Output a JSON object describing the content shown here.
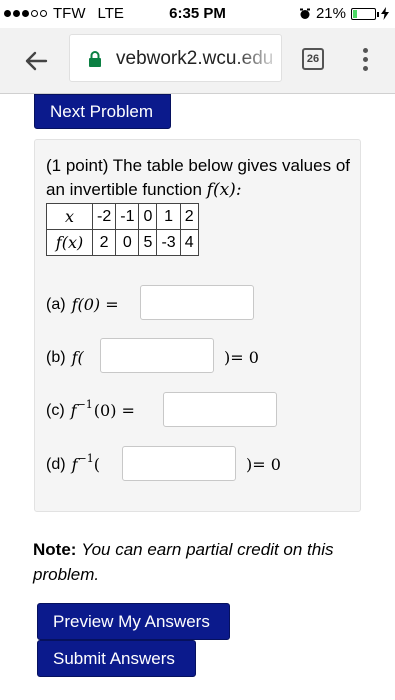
{
  "status_bar": {
    "carrier": "TFW",
    "network": "LTE",
    "time": "6:35 PM",
    "battery": "21%",
    "battery_level": 0.21
  },
  "browser": {
    "url": "vebwork2.wcu.edu",
    "tab_count": "26",
    "colors": {
      "secure": "#0b8043"
    }
  },
  "page": {
    "next_problem_label": "Next Problem",
    "problem": {
      "points": "(1 point)",
      "intro": "The table below gives values of an invertible function",
      "function_name": "f(x):",
      "table": {
        "row1_head": "x",
        "row2_head": "f(x)",
        "x_values": [
          "-2",
          "-1",
          "0",
          "1",
          "2"
        ],
        "fx_values": [
          "2",
          "0",
          "5",
          "-3",
          "4"
        ]
      },
      "parts": {
        "a": {
          "label": "(a)",
          "expr": "f(0) =",
          "value": ""
        },
        "b": {
          "label": "(b)",
          "pre": "f(",
          "post": ")= 0",
          "value": ""
        },
        "c": {
          "label": "(c)",
          "expr_f": "f",
          "expr_sup": "−1",
          "expr_rest": "(0) =",
          "value": ""
        },
        "d": {
          "label": "(d)",
          "expr_f": "f",
          "expr_sup": "−1",
          "expr_open": "(",
          "post": ")= 0",
          "value": ""
        }
      }
    },
    "note": {
      "label": "Note:",
      "text": "You can earn partial credit on this problem."
    },
    "preview_label": "Preview My Answers",
    "submit_label": "Submit Answers",
    "colors": {
      "button": "#0b1a8c"
    }
  }
}
